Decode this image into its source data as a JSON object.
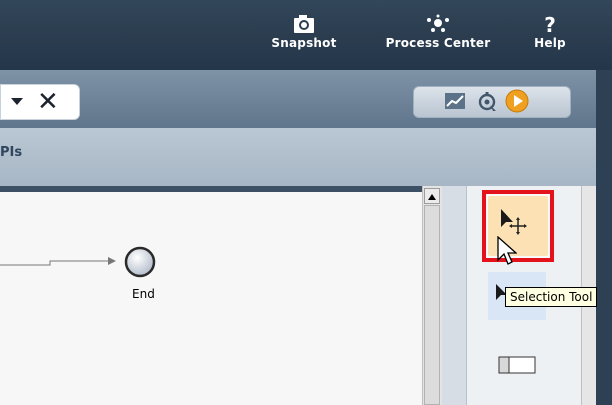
{
  "header": {
    "buttons": [
      {
        "label": "Snapshot",
        "icon": "camera-icon"
      },
      {
        "label": "Process Center",
        "icon": "process-center-icon"
      },
      {
        "label": "Help",
        "icon": "question-mark-icon"
      }
    ]
  },
  "toolbar": {
    "tab_close_symbol": "✕",
    "tools": [
      {
        "icon": "chart-icon"
      },
      {
        "icon": "gear-inspect-icon"
      },
      {
        "icon": "play-icon"
      }
    ]
  },
  "subtab": {
    "label": "PIs"
  },
  "diagram": {
    "end_event_label": "End"
  },
  "palette": {
    "tooltip": "Selection Tool",
    "highlight_color": "#e3121b",
    "selected_bg": "#fbe1b4"
  },
  "colors": {
    "header_bg": "#2b3d4f",
    "toolbar_bg": "#6f859b",
    "play_orange": "#f0a020"
  }
}
